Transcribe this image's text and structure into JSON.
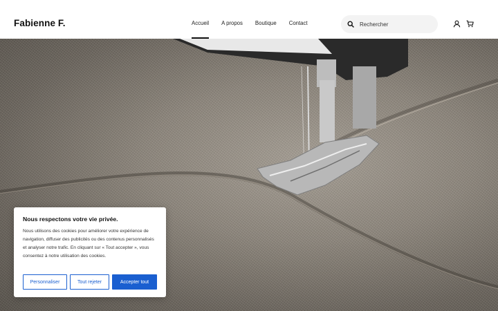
{
  "header": {
    "logo": "Fabienne F.",
    "nav": [
      {
        "label": "Accueil",
        "active": true
      },
      {
        "label": "A propos",
        "active": false
      },
      {
        "label": "Boutique",
        "active": false
      },
      {
        "label": "Contact",
        "active": false
      }
    ],
    "search": {
      "placeholder": "Rechercher",
      "icon": "search-icon"
    },
    "icons": [
      "account-icon",
      "cart-icon"
    ]
  },
  "hero": {
    "image": "sewing-machine-presser-foot-on-canvas-fabric"
  },
  "cookie_banner": {
    "title": "Nous respectons votre vie privée.",
    "text": "Nous utilisons des cookies pour améliorer votre expérience de navigation, diffuser des publicités ou des contenus personnalisés et analyser notre trafic. En cliquant sur « Tout accepter », vous consentez à notre utilisation des cookies.",
    "buttons": {
      "personalize": "Personnaliser",
      "reject": "Tout rejeter",
      "accept": "Accepter tout"
    },
    "accent_color": "#1a5fd0"
  }
}
